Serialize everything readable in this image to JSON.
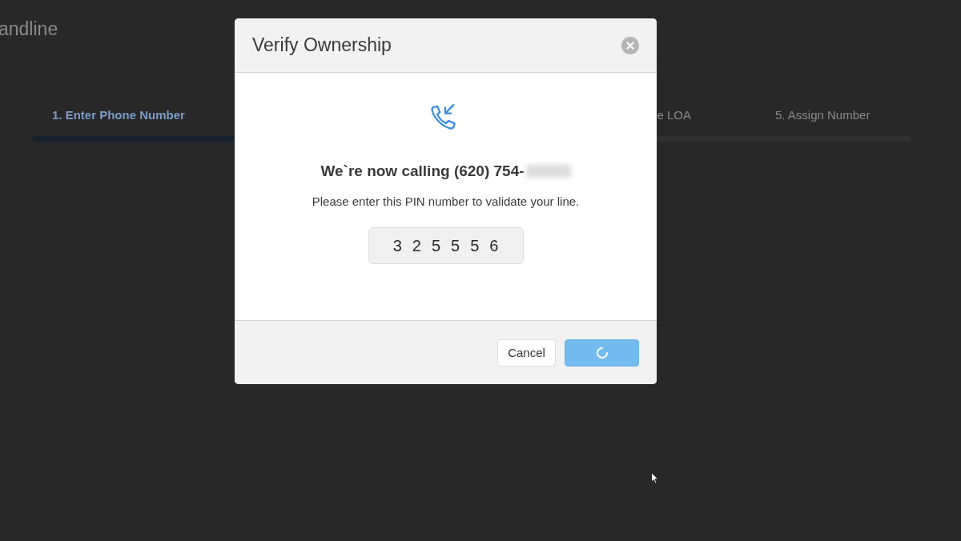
{
  "page": {
    "title": "andline",
    "steps": [
      {
        "label": "1. Enter Phone Number",
        "selected": true
      },
      {
        "label": "e LOA",
        "selected": false
      },
      {
        "label": "5. Assign Number",
        "selected": false
      }
    ],
    "progress": {
      "level": 0.25
    }
  },
  "dialog": {
    "title": "Verify Ownership",
    "heading": "We`re now calling (620) 754-",
    "redacted": true,
    "message": "Please enter this PIN number to validate your line.",
    "pin": [
      "3",
      "2",
      "5",
      "5",
      "5",
      "6"
    ],
    "buttons": [
      {
        "kind": "secondary",
        "label": "Cancel"
      },
      {
        "kind": "loading"
      }
    ]
  }
}
